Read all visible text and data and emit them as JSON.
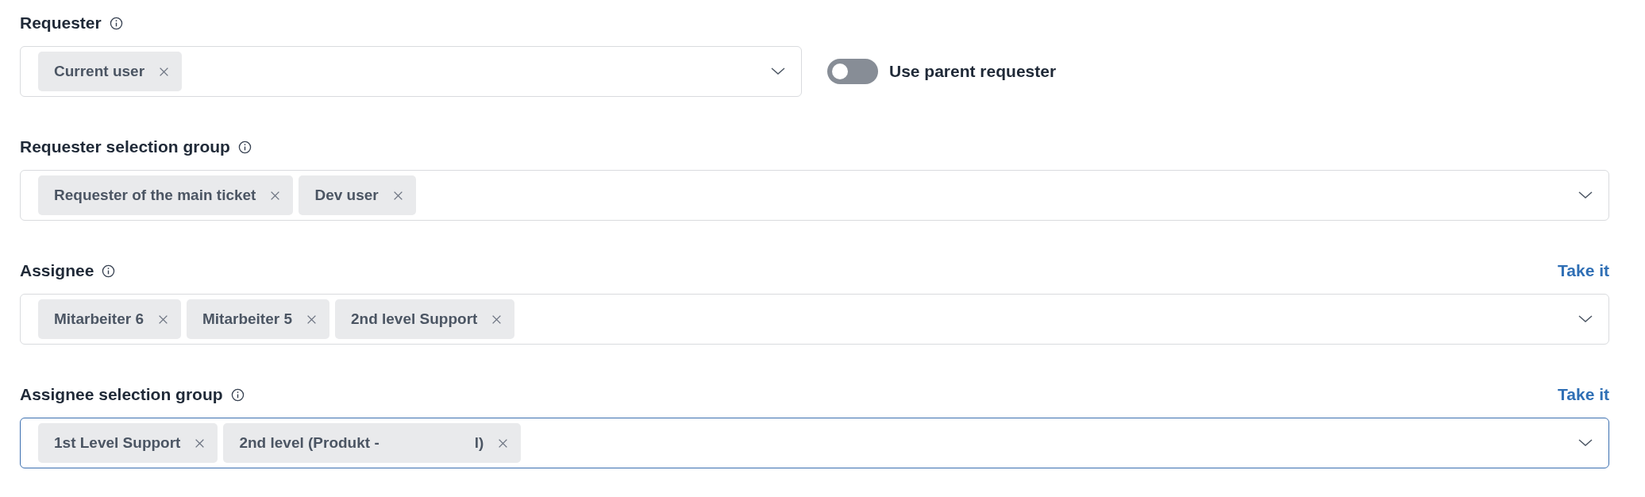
{
  "fields": [
    {
      "label": "Requester",
      "focused": false,
      "chips": [
        {
          "label": "Current user"
        }
      ],
      "toggle": {
        "label": "Use parent requester",
        "on": false
      }
    },
    {
      "label": "Requester selection group",
      "focused": false,
      "chips": [
        {
          "label": "Requester of the main ticket"
        },
        {
          "label": "Dev user"
        }
      ]
    },
    {
      "label": "Assignee",
      "focused": false,
      "action": "Take it",
      "chips": [
        {
          "label": "Mitarbeiter 6"
        },
        {
          "label": "Mitarbeiter 5"
        },
        {
          "label": "2nd level Support"
        }
      ]
    },
    {
      "label": "Assignee selection group",
      "focused": true,
      "action": "Take it",
      "chips": [
        {
          "label": "1st Level Support"
        },
        {
          "label": "2nd level (Produkt -",
          "tail": "l)"
        }
      ]
    }
  ]
}
